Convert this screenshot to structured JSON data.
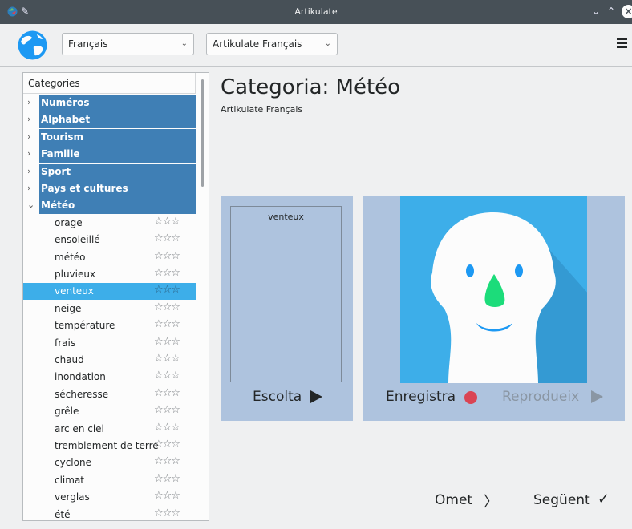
{
  "window": {
    "title": "Artikulate"
  },
  "toolbar": {
    "language": "Français",
    "course": "Artikulate Français"
  },
  "categories_panel": {
    "header": "Categories",
    "categories": [
      {
        "label": "Numéros",
        "expanded": false
      },
      {
        "label": "Alphabet",
        "expanded": false
      },
      {
        "label": "Tourism",
        "expanded": false
      },
      {
        "label": "Famille",
        "expanded": false
      },
      {
        "label": "Sport",
        "expanded": false
      },
      {
        "label": "Pays et cultures",
        "expanded": false
      },
      {
        "label": "Météo",
        "expanded": true
      }
    ],
    "words": [
      {
        "label": "orage",
        "stars": "☆☆☆"
      },
      {
        "label": "ensoleillé",
        "stars": "☆☆☆"
      },
      {
        "label": "météo",
        "stars": "☆☆☆"
      },
      {
        "label": "pluvieux",
        "stars": "☆☆☆"
      },
      {
        "label": "venteux",
        "stars": "☆☆☆",
        "selected": true
      },
      {
        "label": "neige",
        "stars": "☆☆☆"
      },
      {
        "label": "température",
        "stars": "☆☆☆"
      },
      {
        "label": "frais",
        "stars": "☆☆☆"
      },
      {
        "label": "chaud",
        "stars": "☆☆☆"
      },
      {
        "label": "inondation",
        "stars": "☆☆☆"
      },
      {
        "label": "sécheresse",
        "stars": "☆☆☆"
      },
      {
        "label": "grêle",
        "stars": "☆☆☆"
      },
      {
        "label": "arc en ciel",
        "stars": "☆☆☆"
      },
      {
        "label": "tremblement de terre",
        "stars": "☆☆☆"
      },
      {
        "label": "cyclone",
        "stars": "☆☆☆"
      },
      {
        "label": "climat",
        "stars": "☆☆☆"
      },
      {
        "label": "verglas",
        "stars": "☆☆☆"
      },
      {
        "label": "été",
        "stars": "☆☆☆"
      }
    ]
  },
  "main": {
    "title": "Categoria: Météo",
    "subtitle": "Artikulate Français",
    "current_word": "venteux",
    "listen_label": "Escolta",
    "record_label": "Enregistra",
    "replay_label": "Reprodueix",
    "skip_label": "Omet",
    "next_label": "Següent"
  },
  "colors": {
    "selection": "#3daee9",
    "category_bg": "#3f7fb5",
    "panel_bg": "#aec3de",
    "record": "#da4453"
  }
}
